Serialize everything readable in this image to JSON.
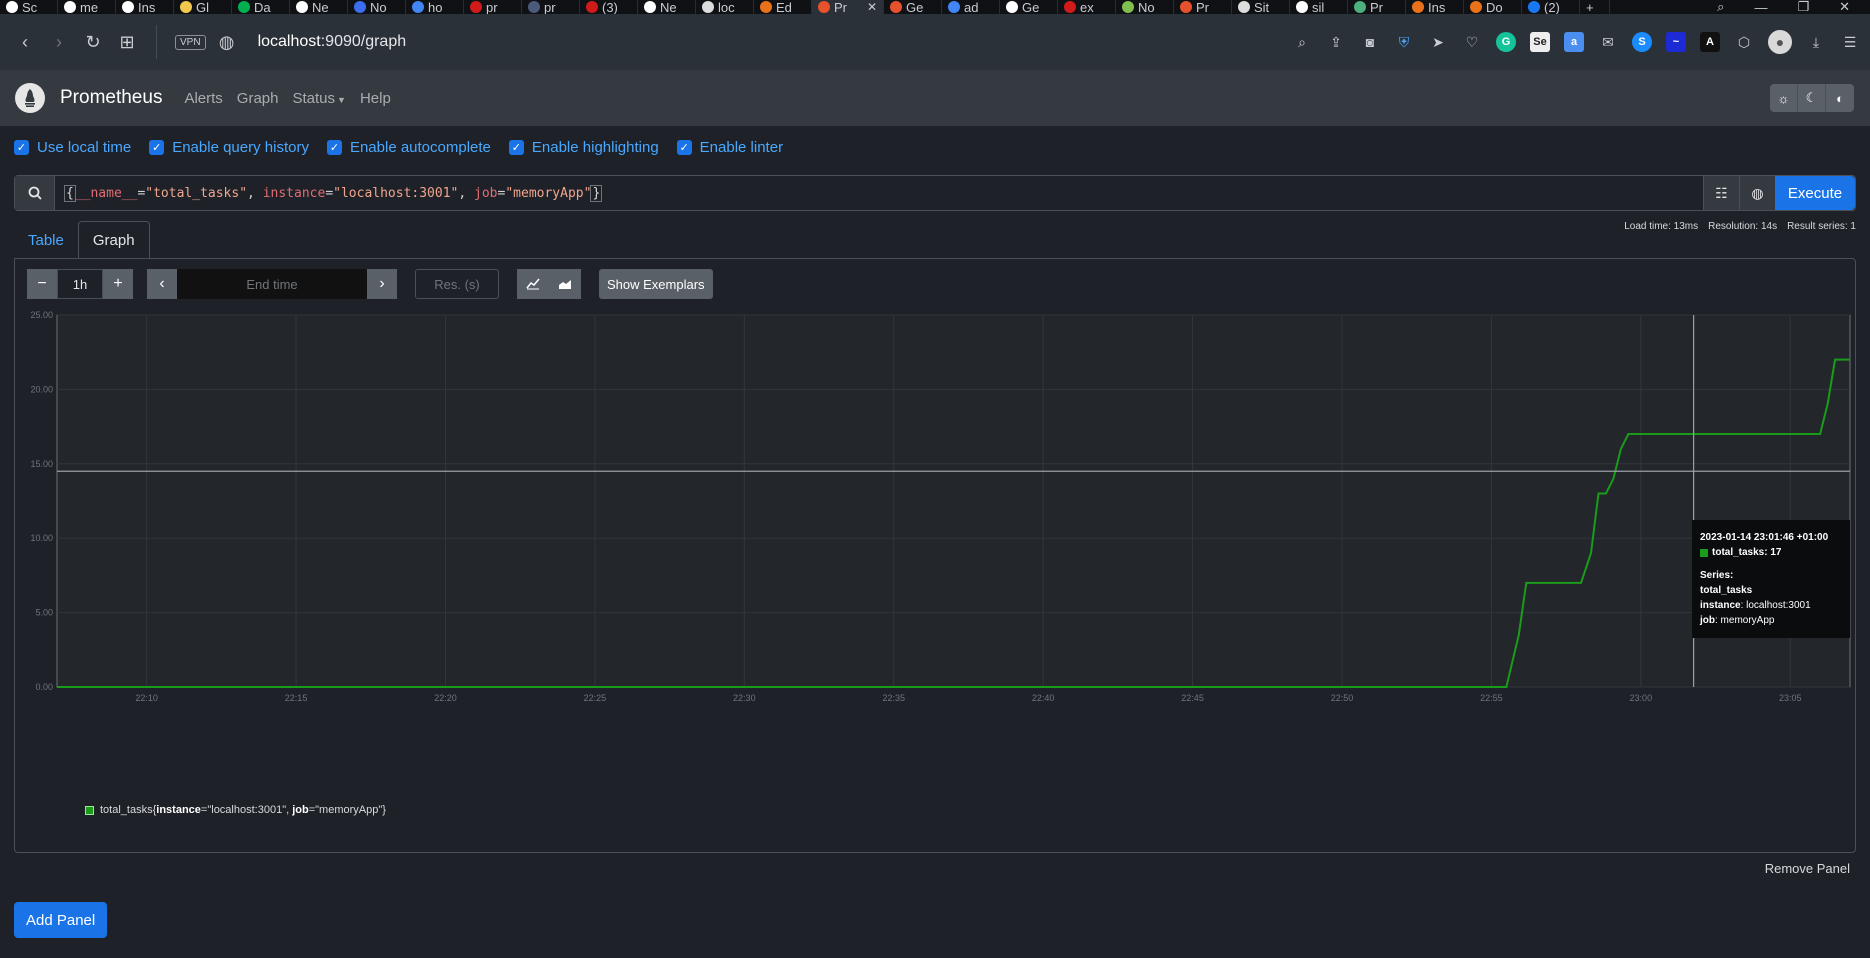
{
  "browser": {
    "tabs": [
      {
        "label": "Sc",
        "color": "#ffffff"
      },
      {
        "label": "me",
        "color": "#ffffff"
      },
      {
        "label": "Ins",
        "color": "#ffffff"
      },
      {
        "label": "Gl",
        "color": "#f2c94c"
      },
      {
        "label": "Da",
        "color": "#00b050"
      },
      {
        "label": "Ne",
        "color": "#ffffff"
      },
      {
        "label": "No",
        "color": "#3a6df0"
      },
      {
        "label": "ho",
        "color": "#4285f4"
      },
      {
        "label": "pr",
        "color": "#d11a1a"
      },
      {
        "label": "pr",
        "color": "#4b5a7a"
      },
      {
        "label": "(3)",
        "color": "#d11a1a"
      },
      {
        "label": "Ne",
        "color": "#ffffff"
      },
      {
        "label": "loc",
        "color": "#dddddd"
      },
      {
        "label": "Ed",
        "color": "#e8711a"
      },
      {
        "label": "Pr",
        "color": "#e6522c",
        "active": true,
        "close": "✕"
      },
      {
        "label": "Ge",
        "color": "#e6522c"
      },
      {
        "label": "ad",
        "color": "#4285f4"
      },
      {
        "label": "Ge",
        "color": "#ffffff"
      },
      {
        "label": "ex",
        "color": "#d11a1a"
      },
      {
        "label": "No",
        "color": "#7fbf4d"
      },
      {
        "label": "Pr",
        "color": "#e6522c"
      },
      {
        "label": "Sit",
        "color": "#dddddd"
      },
      {
        "label": "sil",
        "color": "#ffffff"
      },
      {
        "label": "Pr",
        "color": "#4caf7d"
      },
      {
        "label": "Ins",
        "color": "#e8711a"
      },
      {
        "label": "Do",
        "color": "#e8711a"
      },
      {
        "label": "(2)",
        "color": "#1877f2"
      }
    ],
    "new_tab": "+",
    "vpn": "VPN",
    "url_host": "localhost",
    "url_path": ":9090/graph"
  },
  "navbar": {
    "brand": "Prometheus",
    "items": [
      "Alerts",
      "Graph"
    ],
    "status": "Status",
    "help": "Help"
  },
  "options": [
    "Use local time",
    "Enable query history",
    "Enable autocomplete",
    "Enable highlighting",
    "Enable linter"
  ],
  "query": {
    "open_brace": "{",
    "name_label": "__name__",
    "eq1": "=",
    "name_value": "\"total_tasks\"",
    "comma1": ", ",
    "instance_label": "instance",
    "eq2": "=",
    "instance_value": "\"localhost:3001\"",
    "comma2": ", ",
    "job_label": "job",
    "eq3": "=",
    "job_value": "\"memoryApp\"",
    "close_brace": "}",
    "execute": "Execute"
  },
  "stats": {
    "load_time": "Load time: 13ms",
    "resolution": "Resolution: 14s",
    "result_series": "Result series: 1"
  },
  "tabs": {
    "table": "Table",
    "graph": "Graph"
  },
  "controls": {
    "minus": "−",
    "range": "1h",
    "plus": "+",
    "prev": "‹",
    "end_time_placeholder": "End time",
    "next": "›",
    "res_placeholder": "Res. (s)",
    "show_exemplars": "Show Exemplars"
  },
  "chart_data": {
    "type": "line",
    "x_ticks": [
      "22:10",
      "22:15",
      "22:20",
      "22:25",
      "22:30",
      "22:35",
      "22:40",
      "22:45",
      "22:50",
      "22:55",
      "23:00",
      "23:05"
    ],
    "y_ticks": [
      "0.00",
      "5.00",
      "10.00",
      "15.00",
      "20.00",
      "25.00"
    ],
    "ylim": [
      0,
      25
    ],
    "x_range": [
      "22:07",
      "23:07"
    ],
    "grid": true,
    "series": [
      {
        "name": "total_tasks",
        "color": "#1a9c1a",
        "points": [
          [
            "22:07:00",
            0
          ],
          [
            "22:55:30",
            0
          ],
          [
            "22:55:55",
            3.5
          ],
          [
            "22:56:10",
            7
          ],
          [
            "22:58:00",
            7
          ],
          [
            "22:58:20",
            9
          ],
          [
            "22:58:35",
            13
          ],
          [
            "22:58:50",
            13
          ],
          [
            "22:59:05",
            14
          ],
          [
            "22:59:20",
            16
          ],
          [
            "22:59:35",
            17
          ],
          [
            "23:06:00",
            17
          ],
          [
            "23:06:15",
            19
          ],
          [
            "23:06:30",
            22
          ],
          [
            "23:07:00",
            22
          ]
        ]
      }
    ],
    "crosshair": {
      "x": "23:01:46",
      "y": 14.5
    }
  },
  "legend": {
    "metric": "total_tasks",
    "open": "{",
    "instance_key": "instance",
    "instance_val": "=\"localhost:3001\", ",
    "job_key": "job",
    "job_val": "=\"memoryApp\"",
    "close": "}"
  },
  "tooltip": {
    "date": "2023-01-14 23:01:46 +01:00",
    "value_line": "total_tasks: 17",
    "series_heading": "Series:",
    "metric": "total_tasks",
    "instance_label": "instance",
    "instance_value": ": localhost:3001",
    "job_label": "job",
    "job_value": ": memoryApp"
  },
  "remove_panel": "Remove Panel",
  "add_panel": "Add Panel"
}
